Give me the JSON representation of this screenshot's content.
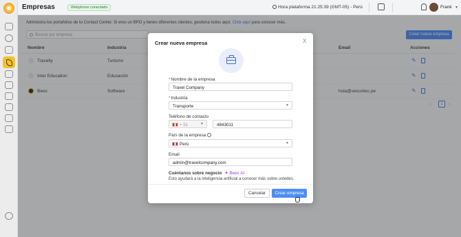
{
  "header": {
    "title": "Empresas",
    "badge": "Webphone conectado",
    "time": "Hora plataforma 21:25:39 (GMT-05) - Perú",
    "user": "Frank"
  },
  "page": {
    "intro": "Administra los portafolios de tu Contact Center. Si eres un BPO y tienes diferentes clientes, gestiona todos aquí.",
    "intro_link": "Click aquí",
    "intro_tail": "para conocer más.",
    "search_placeholder": "Buscar por empresa",
    "new_button": "Crear nueva empresa"
  },
  "table": {
    "columns": {
      "name": "Nombre",
      "industry": "Industria",
      "email": "Email",
      "actions": "Acciones"
    },
    "rows": [
      {
        "name": "Travelty",
        "industry": "Turismo",
        "email": ""
      },
      {
        "name": "Inter Education",
        "industry": "Educación",
        "email": ""
      },
      {
        "name": "Beex",
        "industry": "Software",
        "email": "hola@securitec.pe"
      }
    ],
    "page": "1"
  },
  "modal": {
    "title": "Crear nueva empresa",
    "close": "X",
    "company_label": "Nombre de la empresa",
    "company_value": "Travel Company",
    "industry_label": "Industria",
    "industry_value": "Transporte",
    "phone_label": "Teléfono de contacto",
    "phone_code": "+ 51",
    "phone_value": "4843011",
    "country_label": "País de la empresa",
    "country_value": "Perú",
    "email_label": "Email",
    "email_value": "admin@travelcompany.com",
    "about_label": "Cuéntanos sobre negocio",
    "ai_tag": "Beex AI",
    "hint": "Esto ayudará a la inteligencia artificial a conocer más sobre ustedes.",
    "cancel": "Cancelar",
    "create": "Crear empresa"
  },
  "colors": {
    "accent": "#3b82f6",
    "active_nav": "#f1c232",
    "required": "#e03b3b",
    "ai": "#9b3fd6"
  }
}
